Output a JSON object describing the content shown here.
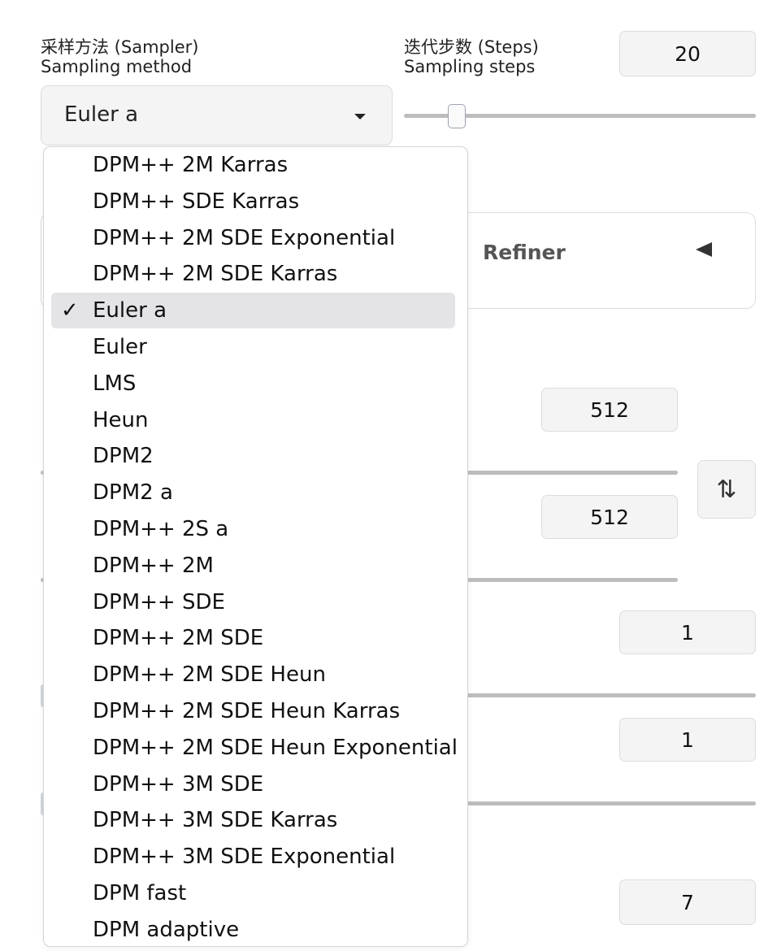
{
  "sampler": {
    "label_zh": "采样方法 (Sampler)",
    "label_en": "Sampling method",
    "selected": "Euler a",
    "options": [
      "DPM++ 2M Karras",
      "DPM++ SDE Karras",
      "DPM++ 2M SDE Exponential",
      "DPM++ 2M SDE Karras",
      "Euler a",
      "Euler",
      "LMS",
      "Heun",
      "DPM2",
      "DPM2 a",
      "DPM++ 2S a",
      "DPM++ 2M",
      "DPM++ SDE",
      "DPM++ 2M SDE",
      "DPM++ 2M SDE Heun",
      "DPM++ 2M SDE Heun Karras",
      "DPM++ 2M SDE Heun Exponential",
      "DPM++ 3M SDE",
      "DPM++ 3M SDE Karras",
      "DPM++ 3M SDE Exponential",
      "DPM fast",
      "DPM adaptive"
    ],
    "checkmark": "✓"
  },
  "steps": {
    "label_zh": "迭代步数 (Steps)",
    "label_en": "Sampling steps",
    "value": "20",
    "slider_fraction": 0.15
  },
  "refiner": {
    "label": "Refiner",
    "icon": "collapse-triangle-icon"
  },
  "width": {
    "value": "512"
  },
  "height": {
    "value": "512"
  },
  "swap": {
    "glyph": "⇅",
    "icon": "swap-dimensions-icon"
  },
  "batch_count": {
    "value": "1"
  },
  "batch_size": {
    "value": "1"
  },
  "cfg_scale": {
    "value": "7"
  },
  "colors": {
    "accent_selected": "#e4e4e7",
    "field_bg": "#f4f4f5",
    "track": "#bdbdbd"
  }
}
